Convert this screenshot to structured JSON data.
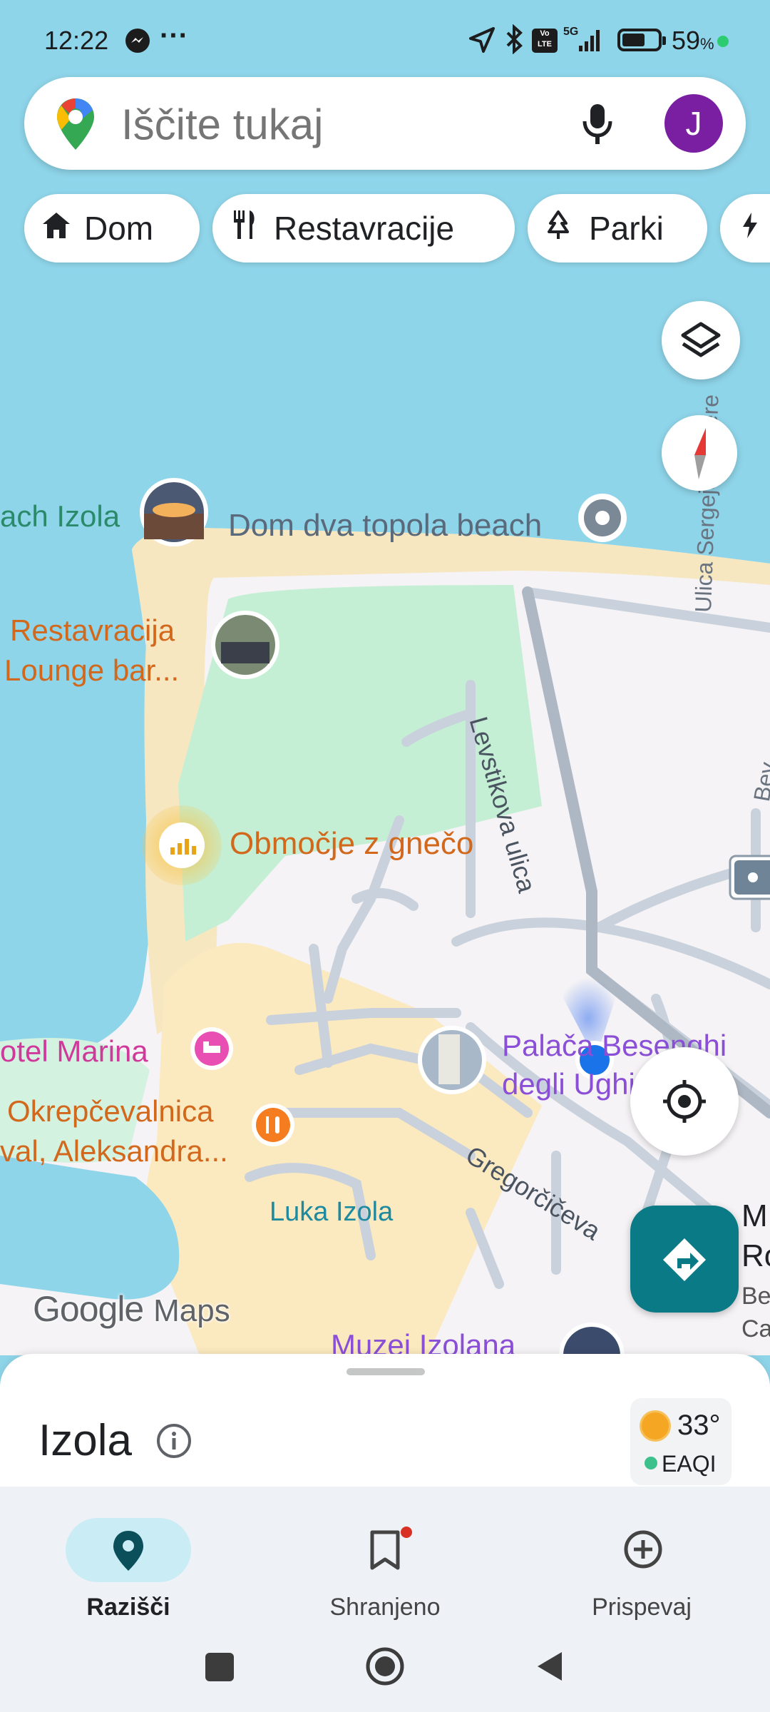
{
  "status": {
    "time": "12:22",
    "battery": "59",
    "battery_unit": "%",
    "network": "5G"
  },
  "search": {
    "placeholder": "Iščite tukaj",
    "avatar_letter": "J"
  },
  "chips": [
    {
      "label": "Dom",
      "icon": "home-icon"
    },
    {
      "label": "Restavracije",
      "icon": "fork-knife-icon"
    },
    {
      "label": "Parki",
      "icon": "tree-icon"
    }
  ],
  "map": {
    "labels": {
      "beach_izola": "ach Izola",
      "dom_dva_topola": "Dom dva topola beach",
      "restavracija_1": "Restavracija",
      "restavracija_2": "Lounge bar...",
      "crowd_area": "Območje z gnečo",
      "hotel_marina": "otel Marina",
      "okrepcevalnica_1": "Okrepčevalnica",
      "okrepcevalnica_2": "val, Aleksandra...",
      "palaca_1": "Palača Besenghi",
      "palaca_2": "degli Ughi",
      "luka_izola": "Luka Izola",
      "muzej": "Muzej Izolana",
      "street_levstikova": "Levstikova ulica",
      "street_sergeja": "Ulica Sergeja Mašere",
      "street_gregorciceva": "Gregorčičeva",
      "street_bev": "Bev",
      "right_m": "M",
      "right_ro": "Ro",
      "right_be": "Be",
      "right_ca": "Ca"
    },
    "watermark_google": "Google",
    "watermark_maps": "Maps"
  },
  "sheet": {
    "title": "Izola",
    "temperature": "33°",
    "aqi_label": "EAQI"
  },
  "nav": [
    {
      "label": "Razišči",
      "icon": "location-pin-icon",
      "active": true
    },
    {
      "label": "Shranjeno",
      "icon": "bookmark-icon",
      "active": false
    },
    {
      "label": "Prispevaj",
      "icon": "add-circle-icon",
      "active": false
    }
  ],
  "colors": {
    "accent_teal": "#0b7a87",
    "avatar": "#7b1fa2",
    "water": "#8fd5ea",
    "park": "#c5efd5",
    "sand": "#f6e7c1",
    "nav_active": "#c9ecf5"
  }
}
